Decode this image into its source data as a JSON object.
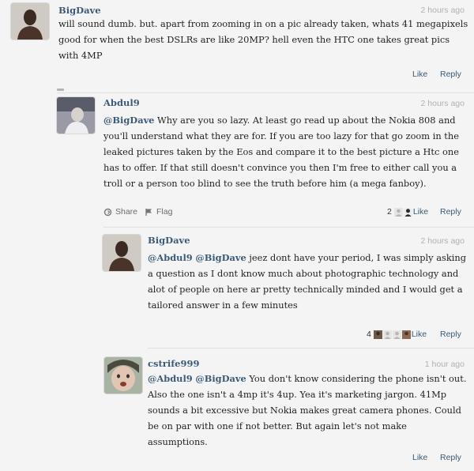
{
  "comments": [
    {
      "author": "BigDave",
      "time": "2 hours ago",
      "text": "will sound dumb. but. apart from zooming in on a pic already taken, whats 41 megapixels good for when the best DSLRs are like 20MP? hell even the HTC one takes great pics with 4MP",
      "like_label": "Like",
      "reply_label": "Reply"
    },
    {
      "author": "Abdul9",
      "time": "2 hours ago",
      "mention1": "@BigDave",
      "text": " Why are you so lazy. At least go read up about the Nokia 808 and you'll understand what they are for. If you are too lazy for that go zoom in the leaked pictures taken by the Eos and compare it to the best picture a Htc one has to offer. If that still doesn't convince you then I'm free to either call you a troll or a person too blind to see the truth before him (a mega fanboy).",
      "share_label": "Share",
      "flag_label": "Flag",
      "like_count": "2",
      "like_label": "Like",
      "reply_label": "Reply"
    },
    {
      "author": "BigDave",
      "time": "2 hours ago",
      "mention1": "@Abdul9",
      "mention2": "@BigDave",
      "text": " jeez dont have your period, I was simply asking a question as I dont know much about photographic technology and alot of people on here ar pretty technically minded and I would get a tailored answer in a few minutes",
      "like_count": "4",
      "like_label": "Like",
      "reply_label": "Reply"
    },
    {
      "author": "cstrife999",
      "time": "1 hour ago",
      "mention1": "@Abdul9",
      "mention2": "@BigDave",
      "text": "  You don't know considering the phone isn't out.  Also the one isn't a 4mp it's 4up.  Yea it's marketing jargon.  41Mp sounds a bit excessive but Nokia makes great camera phones.  Could be on par with one if not better.  But again let's not make assumptions.",
      "like_label": "Like",
      "reply_label": "Reply"
    }
  ]
}
